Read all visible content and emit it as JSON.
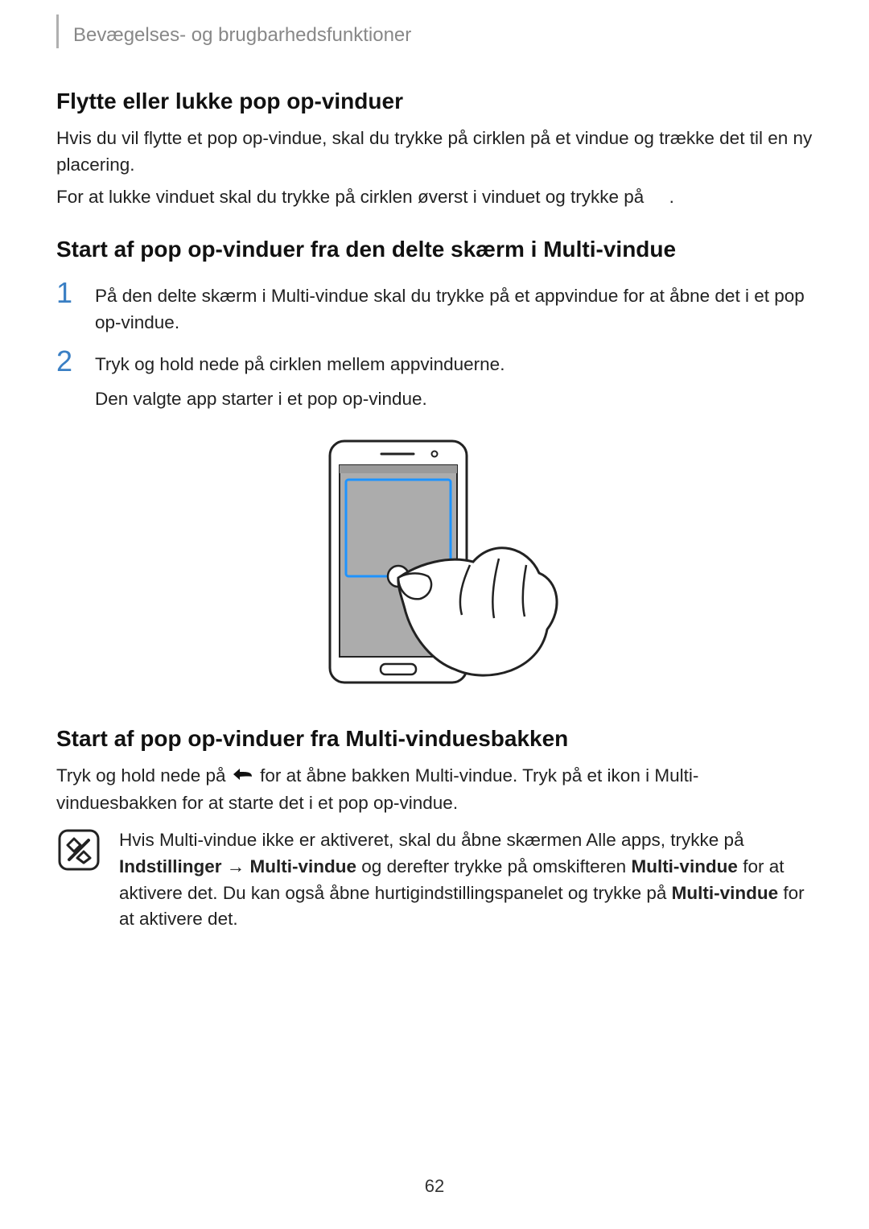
{
  "breadcrumb": "Bevægelses- og brugbarhedsfunktioner",
  "s1": {
    "heading": "Flytte eller lukke pop op-vinduer",
    "p1": "Hvis du vil flytte et pop op-vindue, skal du trykke på cirklen på et vindue og trække det til en ny placering.",
    "p2": "For at lukke vinduet skal du trykke på cirklen øverst i vinduet og trykke på     ."
  },
  "s2": {
    "heading": "Start af pop op-vinduer fra den delte skærm i Multi-vindue",
    "step1": "På den delte skærm i Multi-vindue skal du trykke på et appvindue for at åbne det i et pop op-vindue.",
    "step2a": "Tryk og hold nede på cirklen mellem appvinduerne.",
    "step2b": "Den valgte app starter i et pop op-vindue."
  },
  "s3": {
    "heading": "Start af pop op-vinduer fra Multi-vinduesbakken",
    "p1a": "Tryk og hold nede på ",
    "p1b": " for at åbne bakken Multi-vindue. Tryk på et ikon i Multi-vinduesbakken for at starte det i et pop op-vindue.",
    "note_a": "Hvis Multi-vindue ikke er aktiveret, skal du åbne skærmen Alle apps, trykke på ",
    "note_b1": "Indstillinger",
    "note_arrow": " → ",
    "note_b2": "Multi-vindue",
    "note_c": " og derefter trykke på omskifteren ",
    "note_b3": "Multi-vindue",
    "note_d": " for at aktivere det. Du kan også åbne hurtigindstillingspanelet og trykke på ",
    "note_b4": "Multi-vindue",
    "note_e": " for at aktivere det."
  },
  "page_number": "62"
}
